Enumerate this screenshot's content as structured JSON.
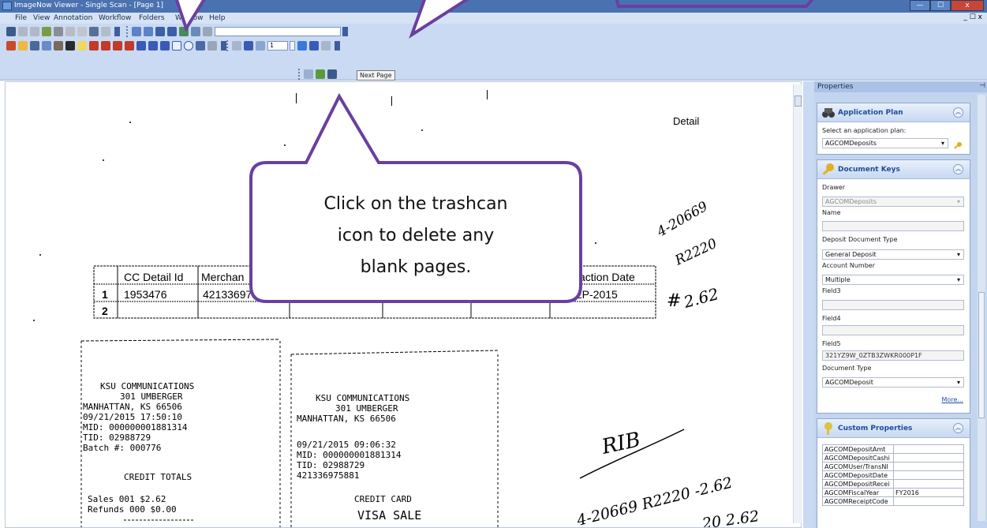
{
  "window": {
    "title": "ImageNow Viewer - Single Scan - [Page 1]",
    "minimize": "—",
    "maximize": "☐",
    "close": "x"
  },
  "menu": {
    "items": [
      "File",
      "View",
      "Annotation",
      "Workflow",
      "Folders",
      "Window",
      "Help"
    ],
    "mdi_controls": "_ ☐ x"
  },
  "toolbar": {
    "page_number": "1",
    "tooltip": "Next Page"
  },
  "callout": {
    "text_lines": [
      "Click on the trashcan",
      "icon to delete any",
      "blank pages."
    ]
  },
  "document": {
    "header_word": "Detail",
    "table": {
      "headers": [
        "CC Detail Id",
        "Merchan",
        "saction Date"
      ],
      "rows": [
        {
          "num": "1",
          "id": "1953476",
          "merchant": "42133697",
          "date": "SEP-2015"
        },
        {
          "num": "2",
          "id": "",
          "merchant": "",
          "date": ""
        }
      ]
    },
    "receipt1": [
      "KSU COMMUNICATIONS",
      "301 UMBERGER",
      "MANHATTAN, KS 66506",
      "09/21/2015       17:50:10",
      "MID:      000000001881314",
      "TID:              02988729",
      "Batch #:            000776",
      "",
      "CREDIT TOTALS",
      "",
      "Sales        001      $2.62",
      "Refunds      000      $0.00"
    ],
    "receipt2": [
      "KSU COMMUNICATIONS",
      "301 UMBERGER",
      "MANHATTAN, KS 66506",
      "",
      "09/21/2015       09:06:32",
      "MID:      000000001881314",
      "TID:              02988729",
      "421336975881",
      "",
      "CREDIT CARD",
      "VISA SALE"
    ],
    "handwriting": {
      "a": "4-20669",
      "b": "R2220",
      "c": "#",
      "d": "2.62",
      "e": "RIB",
      "f": "4-20669 R2220 -2.62",
      "g": "20 2.62"
    }
  },
  "properties": {
    "title": "Properties",
    "application_plan": {
      "title": "Application Plan",
      "label": "Select an application plan:",
      "value": "AGCOMDeposits"
    },
    "document_keys": {
      "title": "Document Keys",
      "drawer_label": "Drawer",
      "drawer_value": "AGCOMDeposits",
      "name_label": "Name",
      "name_value": "",
      "deposit_type_label": "Deposit Document Type",
      "deposit_type_value": "General Deposit",
      "account_label": "Account Number",
      "account_value": "Multiple",
      "field3_label": "Field3",
      "field3_value": "",
      "field4_label": "Field4",
      "field4_value": "",
      "field5_label": "Field5",
      "field5_value": "321YZ9W_0ZTB3ZWKR000P1F",
      "doc_type_label": "Document Type",
      "doc_type_value": "AGCOMDeposit",
      "more": "More..."
    },
    "custom_properties": {
      "title": "Custom Properties",
      "rows": [
        {
          "name": "AGCOMDepositAmt",
          "value": ""
        },
        {
          "name": "AGCOMDepositCashi",
          "value": ""
        },
        {
          "name": "AGCOMUser/TransNI",
          "value": ""
        },
        {
          "name": "AGCOMDepositDate",
          "value": ""
        },
        {
          "name": "AGCOMDepositRecei",
          "value": ""
        },
        {
          "name": "AGCOMFiscalYear",
          "value": "FY2016"
        },
        {
          "name": "AGCOMReceiptCode",
          "value": ""
        }
      ]
    }
  },
  "colors": {
    "callout_border": "#6a3fa0",
    "titlebar": "#4a72b0",
    "toolbar": "#c9daf2",
    "panel_title": "#1f4c9a"
  }
}
